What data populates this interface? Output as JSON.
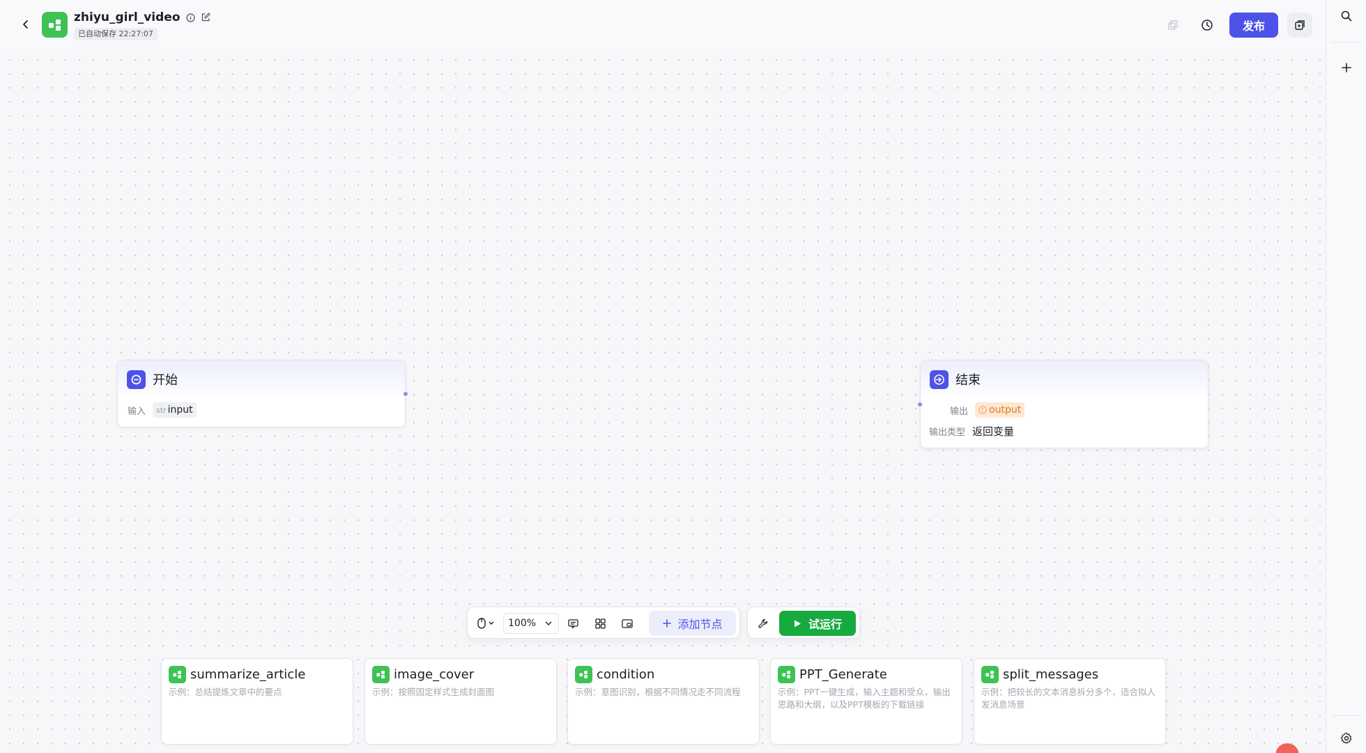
{
  "header": {
    "app_name": "zhiyu_girl_video",
    "autosave_text": "已自动保存 22:27:07",
    "publish_label": "发布"
  },
  "nodes": {
    "start": {
      "title": "开始",
      "input_label": "输入",
      "input_type": "str",
      "input_name": "input"
    },
    "end": {
      "title": "结束",
      "output_label": "输出",
      "output_name": "output",
      "output_type_label": "输出类型",
      "output_type_value": "返回变量"
    }
  },
  "toolbar": {
    "zoom_value": "100%",
    "add_node_label": "添加节点",
    "run_label": "试运行"
  },
  "templates": [
    {
      "title": "summarize_article",
      "desc": "示例：总结提炼文章中的要点"
    },
    {
      "title": "image_cover",
      "desc": "示例：按照固定样式生成封面图"
    },
    {
      "title": "condition",
      "desc": "示例：意图识别，根据不同情况走不同流程"
    },
    {
      "title": "PPT_Generate",
      "desc": "示例：PPT一键生成，输入主题和受众，输出思路和大纲，以及PPT模板的下载链接"
    },
    {
      "title": "split_messages",
      "desc": "示例：把较长的文本消息拆分多个，适合拟人发消息场景"
    }
  ],
  "colors": {
    "accent": "#4d53e8",
    "run": "#17ab3f",
    "app_logo": "#3ec254",
    "warn": "#e27a1c"
  }
}
